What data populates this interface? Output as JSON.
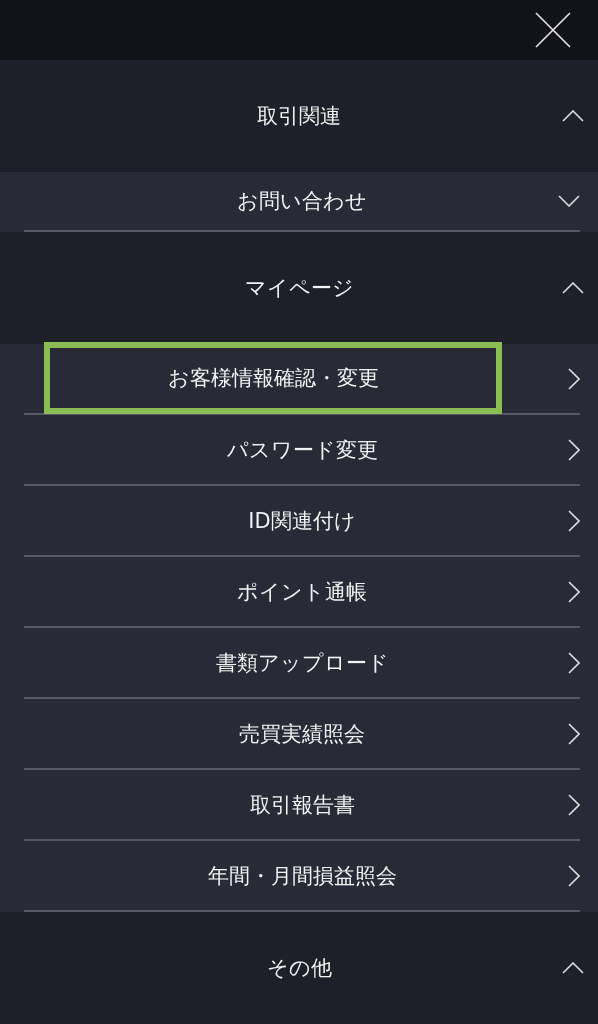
{
  "sections": [
    {
      "title": "取引関連",
      "expanded": true,
      "items": [
        {
          "label": "お問い合わせ",
          "kind": "group",
          "expanded": false,
          "highlighted": false
        }
      ]
    },
    {
      "title": "マイページ",
      "expanded": true,
      "items": [
        {
          "label": "お客様情報確認・変更",
          "kind": "link",
          "highlighted": true
        },
        {
          "label": "パスワード変更",
          "kind": "link",
          "highlighted": false
        },
        {
          "label": "ID関連付け",
          "kind": "link",
          "highlighted": false
        },
        {
          "label": "ポイント通帳",
          "kind": "link",
          "highlighted": false
        },
        {
          "label": "書類アップロード",
          "kind": "link",
          "highlighted": false
        },
        {
          "label": "売買実績照会",
          "kind": "link",
          "highlighted": false
        },
        {
          "label": "取引報告書",
          "kind": "link",
          "highlighted": false
        },
        {
          "label": "年間・月間損益照会",
          "kind": "link",
          "highlighted": false
        }
      ]
    },
    {
      "title": "その他",
      "expanded": true
    }
  ]
}
